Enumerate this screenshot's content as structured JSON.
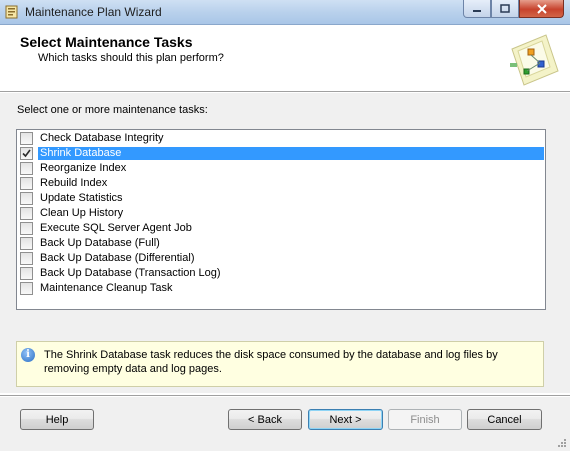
{
  "window": {
    "title": "Maintenance Plan Wizard",
    "buttons": [
      "minimize",
      "maximize",
      "close"
    ]
  },
  "header": {
    "title": "Select Maintenance Tasks",
    "subtitle": "Which tasks should this plan perform?",
    "graphic_icon": "wizard-graphic-icon"
  },
  "main": {
    "prompt": "Select one or more maintenance tasks:",
    "tasks": [
      {
        "label": "Check Database Integrity",
        "checked": false,
        "selected": false
      },
      {
        "label": "Shrink Database",
        "checked": true,
        "selected": true
      },
      {
        "label": "Reorganize Index",
        "checked": false,
        "selected": false
      },
      {
        "label": "Rebuild Index",
        "checked": false,
        "selected": false
      },
      {
        "label": "Update Statistics",
        "checked": false,
        "selected": false
      },
      {
        "label": "Clean Up History",
        "checked": false,
        "selected": false
      },
      {
        "label": "Execute SQL Server Agent Job",
        "checked": false,
        "selected": false
      },
      {
        "label": "Back Up Database (Full)",
        "checked": false,
        "selected": false
      },
      {
        "label": "Back Up Database (Differential)",
        "checked": false,
        "selected": false
      },
      {
        "label": "Back Up Database (Transaction Log)",
        "checked": false,
        "selected": false
      },
      {
        "label": "Maintenance Cleanup Task",
        "checked": false,
        "selected": false
      }
    ],
    "info": "The Shrink Database task reduces the disk space consumed by the database and log files by removing empty data and log pages."
  },
  "footer": {
    "help": "Help",
    "back": "< Back",
    "next": "Next >",
    "finish": "Finish",
    "cancel": "Cancel"
  },
  "colors": {
    "selection": "#3399ff",
    "info_background": "#ffffe1",
    "titlebar": "#b9d1ec"
  }
}
